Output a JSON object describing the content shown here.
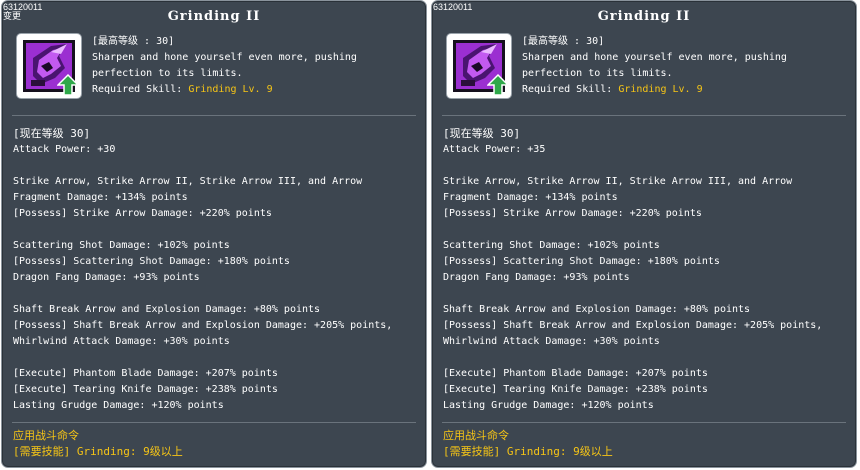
{
  "tooltips": [
    {
      "skill_id": "63120011",
      "id_sub": "变更",
      "title": "Grinding II",
      "max_level": "[最高等级 : 30]",
      "description_lines": [
        "Sharpen and hone yourself even more, pushing",
        "perfection to its limits."
      ],
      "required_label": "Required Skill: ",
      "required_value": "Grinding Lv. 9",
      "current_level": "[现在等级 30]",
      "attack": "Attack Power: +30",
      "effects": [
        "Strike Arrow, Strike Arrow II, Strike Arrow III, and Arrow",
        "Fragment Damage: +134% points",
        "[Possess] Strike Arrow Damage: +220% points",
        "",
        "Scattering Shot Damage: +102% points",
        "[Possess] Scattering Shot Damage: +180% points",
        "Dragon Fang Damage: +93% points",
        "",
        "Shaft Break Arrow and Explosion Damage: +80% points",
        "[Possess] Shaft Break Arrow and Explosion Damage: +205% points,",
        "Whirlwind Attack Damage: +30% points",
        "",
        "[Execute] Phantom Blade Damage: +207% points",
        "[Execute] Tearing Knife Damage: +238% points",
        "Lasting Grudge Damage: +120% points"
      ],
      "footer_1": "应用战斗命令",
      "footer_2": "[需要技能] Grinding: 9级以上"
    },
    {
      "skill_id": "63120011",
      "title": "Grinding II",
      "max_level": "[最高等级 : 30]",
      "description_lines": [
        "Sharpen and hone yourself even more, pushing",
        "perfection to its limits."
      ],
      "required_label": "Required Skill: ",
      "required_value": "Grinding Lv. 9",
      "current_level": "[现在等级 30]",
      "attack": "Attack Power: +35",
      "effects": [
        "Strike Arrow, Strike Arrow II, Strike Arrow III, and Arrow",
        "Fragment Damage: +134% points",
        "[Possess] Strike Arrow Damage: +220% points",
        "",
        "Scattering Shot Damage: +102% points",
        "[Possess] Scattering Shot Damage: +180% points",
        "Dragon Fang Damage: +93% points",
        "",
        "Shaft Break Arrow and Explosion Damage: +80% points",
        "[Possess] Shaft Break Arrow and Explosion Damage: +205% points,",
        "Whirlwind Attack Damage: +30% points",
        "",
        "[Execute] Phantom Blade Damage: +207% points",
        "[Execute] Tearing Knife Damage: +238% points",
        "Lasting Grudge Damage: +120% points"
      ],
      "footer_1": "应用战斗命令",
      "footer_2": "[需要技能] Grinding: 9级以上"
    }
  ],
  "colors": {
    "panel_bg": "#3d4650",
    "highlight": "#f6c516",
    "icon_purple": "#9b2fd1",
    "icon_arrow_green": "#2fa84a"
  },
  "icons": [
    "skill-icon",
    "upgrade-arrow-icon"
  ]
}
